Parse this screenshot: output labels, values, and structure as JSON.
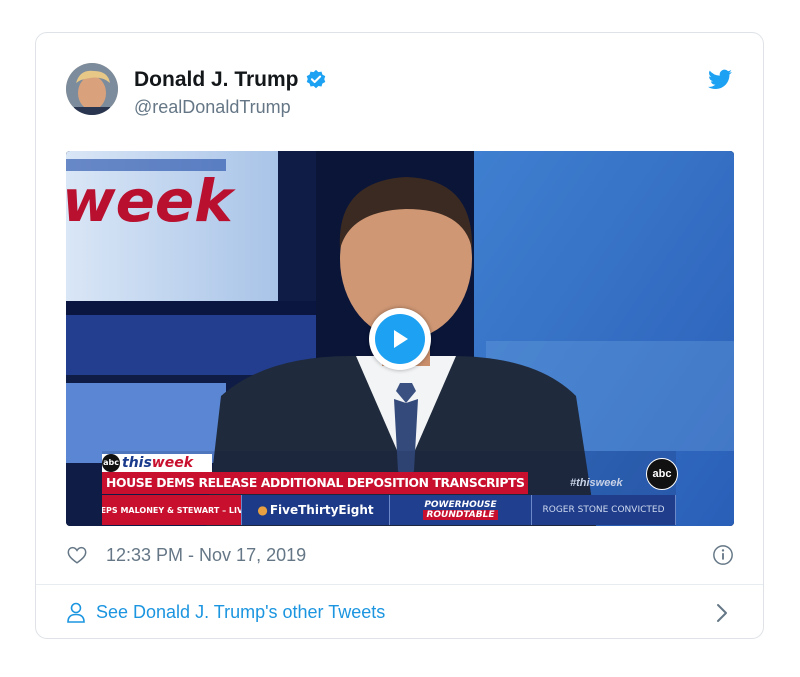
{
  "author": {
    "name": "Donald J. Trump",
    "handle": "@realDonaldTrump"
  },
  "video": {
    "chyron_show_prefix": "this",
    "chyron_show_suffix": "week",
    "chyron_headline": "HOUSE DEMS RELEASE ADDITIONAL DEPOSITION TRANSCRIPTS",
    "hashtag": "#thisweek",
    "network_logo": "abc",
    "ticker": [
      "REPS MALONEY & STEWART – LIVE",
      "FiveThirtyEight",
      "POWERHOUSE",
      "ROUNDTABLE",
      "ROGER STONE CONVICTED"
    ],
    "background_text": "week"
  },
  "tweet": {
    "timestamp": "12:33 PM - Nov 17, 2019"
  },
  "footer": {
    "link_text": "See Donald J. Trump's other Tweets"
  },
  "colors": {
    "twitter_blue": "#1da1f2",
    "link_blue": "#1b95e0",
    "abc_red": "#c8102e"
  }
}
